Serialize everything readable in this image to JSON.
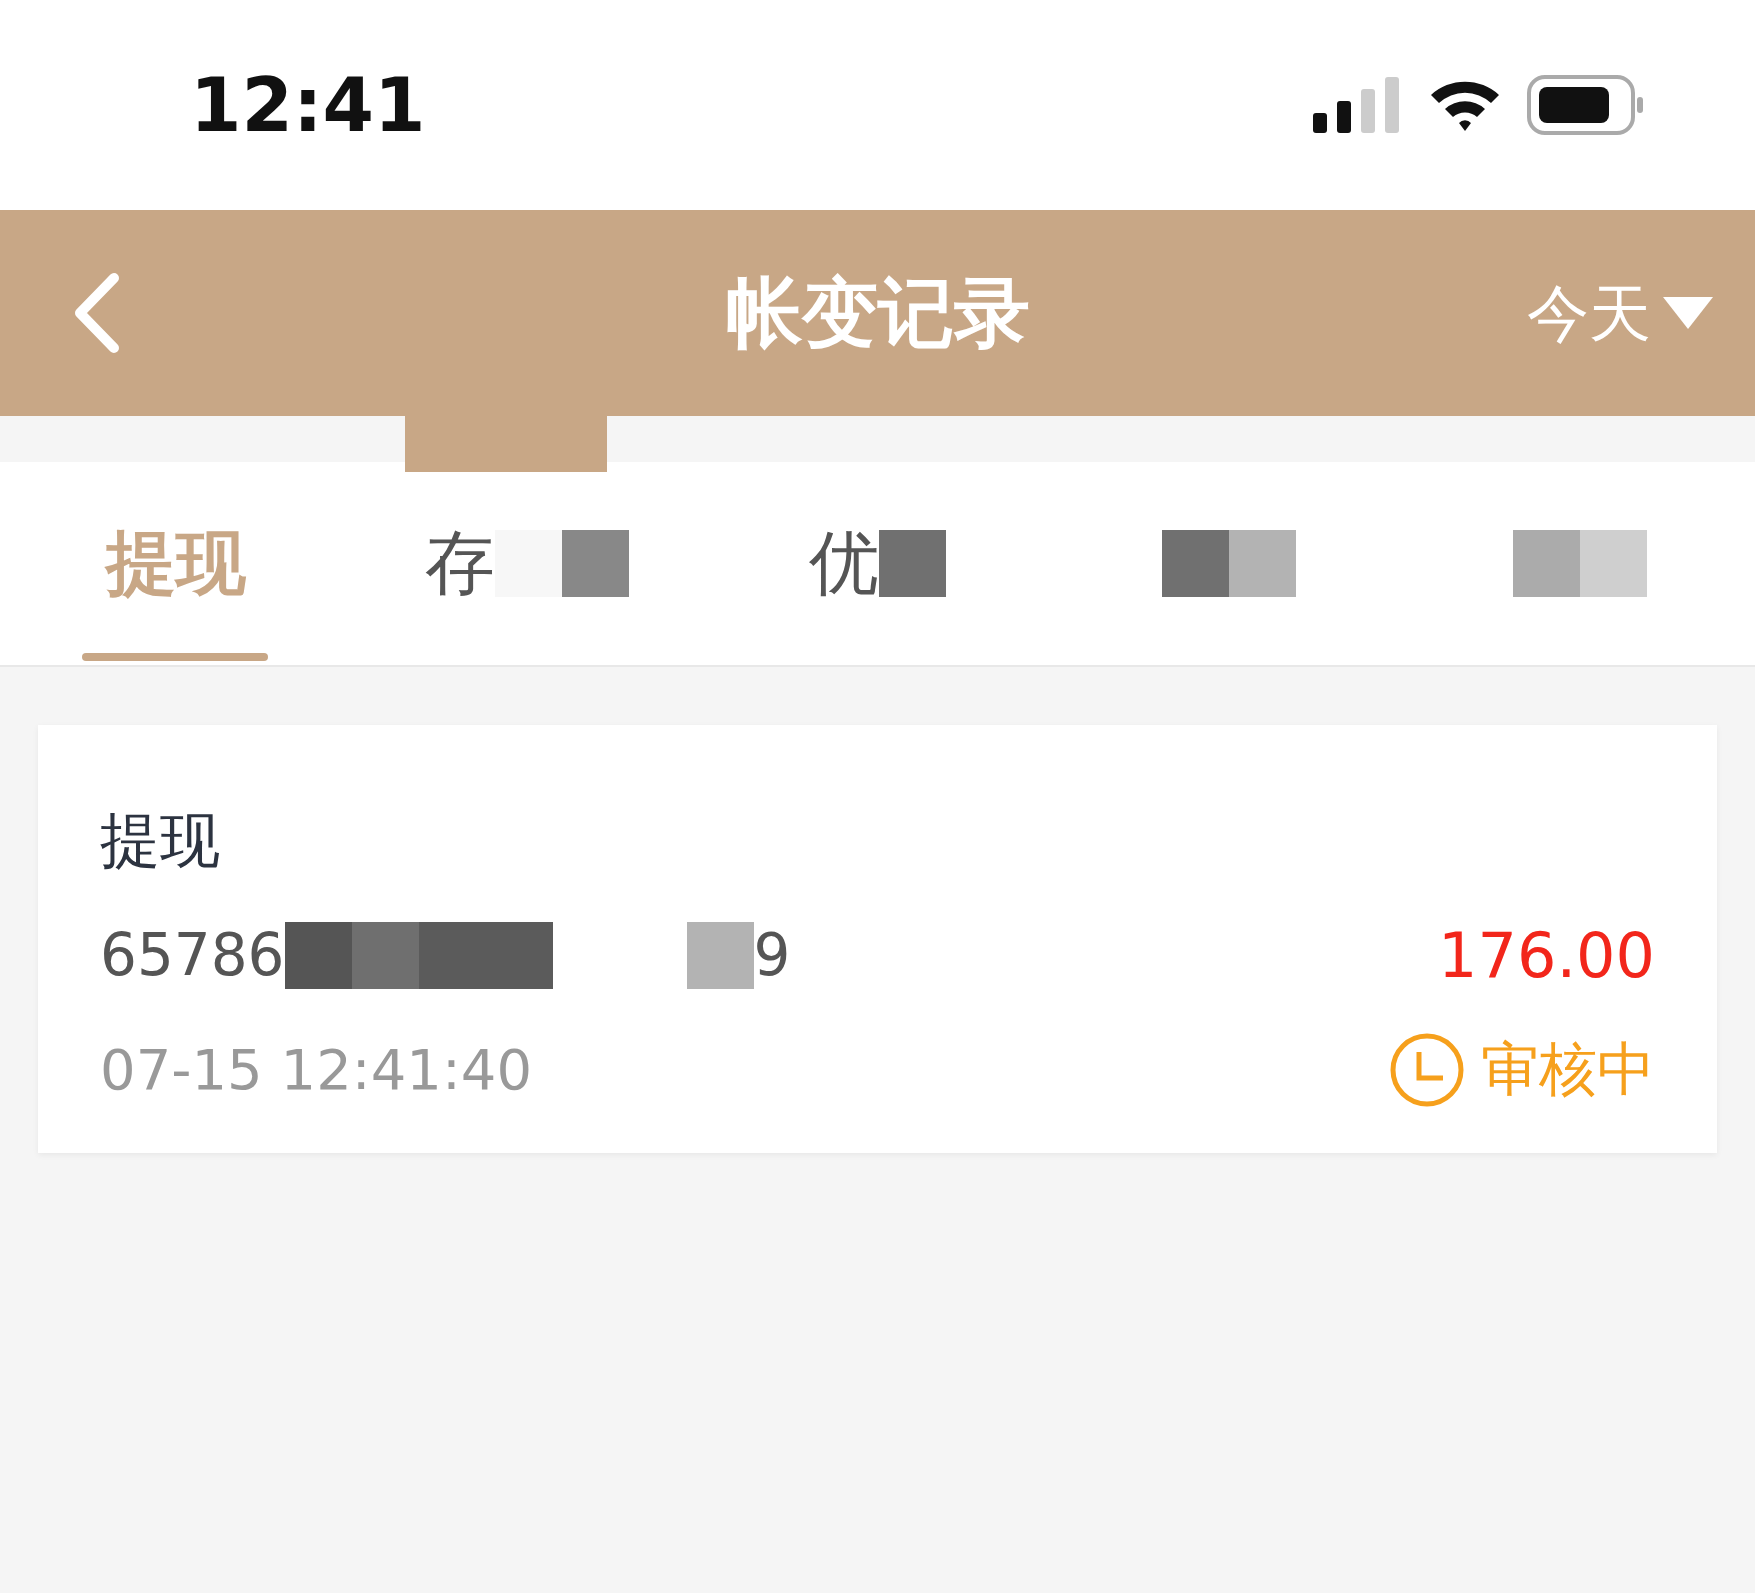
{
  "status_bar": {
    "time": "12:41"
  },
  "header": {
    "title": "帐变记录",
    "filter": "今天"
  },
  "tabs": [
    {
      "label": "提现",
      "selected": true,
      "redacted": false
    },
    {
      "label": "存",
      "selected": false,
      "redacted": true
    },
    {
      "label": "优",
      "selected": false,
      "redacted": true
    },
    {
      "selected": false,
      "redacted": true
    },
    {
      "selected": false,
      "redacted": true
    }
  ],
  "records": [
    {
      "type": "提现",
      "number_start": "65786",
      "number_end": "9",
      "redacted": true,
      "amount": "176.00",
      "time": "07-15 12:41:40",
      "status": "审核中"
    }
  ]
}
